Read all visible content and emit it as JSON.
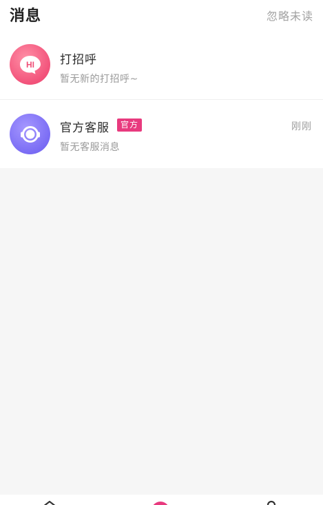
{
  "header": {
    "title": "消息",
    "action_label": "忽略未读"
  },
  "conversations": [
    {
      "name": "打招呼",
      "preview": "暂无新的打招呼~",
      "avatar_icon": "hi-bubble-icon",
      "avatar_text": "HI",
      "avatar_color": "#f2527a"
    },
    {
      "name": "官方客服",
      "badge": "官方",
      "preview": "暂无客服消息",
      "time": "刚刚",
      "avatar_icon": "headset-icon",
      "avatar_color": "#7a6cf4",
      "badge_color": "#e83a7e"
    }
  ],
  "tabbar": {
    "icons": [
      "home-icon",
      "center-tab-icon",
      "profile-icon"
    ],
    "accent": "#e83a7e"
  }
}
